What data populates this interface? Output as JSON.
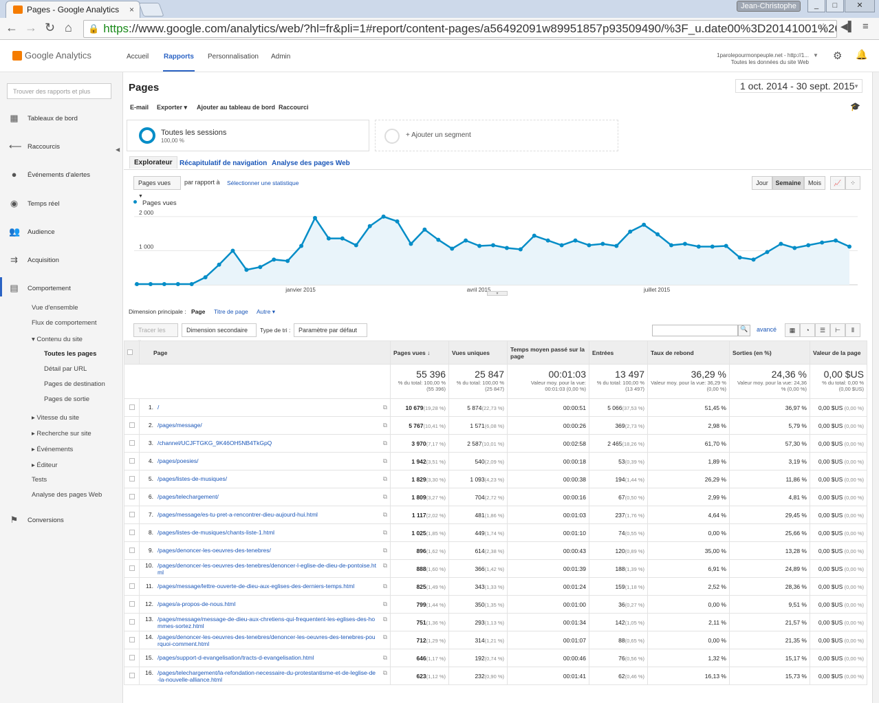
{
  "browser": {
    "tab_title": "Pages - Google Analytics",
    "tab_close": "×",
    "user": "Jean-Christophe",
    "url_https": "https",
    "url_rest": "://www.google.com/analytics/web/?hl=fr&pli=1#report/content-pages/a56492091w89951857p93509490/%3F_u.date00%3D20141001%26_u"
  },
  "header": {
    "logo": "Google Analytics",
    "nav": [
      "Accueil",
      "Rapports",
      "Personnalisation",
      "Admin"
    ],
    "account_line1": "1parolepourmonpeuple.net - http://1...",
    "account_line2": "Toutes les données du site Web"
  },
  "sidebar": {
    "search_placeholder": "Trouver des rapports et plus",
    "items": [
      "Tableaux de bord",
      "Raccourcis",
      "Événements d'alertes",
      "Temps réel",
      "Audience",
      "Acquisition",
      "Comportement",
      "Conversions"
    ],
    "sub": [
      "Vue d'ensemble",
      "Flux de comportement",
      "Contenu du site",
      "Toutes les pages",
      "Détail par URL",
      "Pages de destination",
      "Pages de sortie",
      "Vitesse du site",
      "Recherche sur site",
      "Événements",
      "Éditeur",
      "Tests",
      "Analyse des pages Web"
    ]
  },
  "report": {
    "title": "Pages",
    "date_range": "1 oct. 2014 - 30 sept. 2015",
    "actions": [
      "E-mail",
      "Exporter",
      "Ajouter au tableau de bord",
      "Raccourci"
    ],
    "segment_name": "Toutes les sessions",
    "segment_pct": "100,00 %",
    "add_segment": "+ Ajouter un segment",
    "tabs": [
      "Explorateur",
      "Récapitulatif de navigation",
      "Analyse des pages Web"
    ],
    "metric_select": "Pages vues",
    "par_rapport": "par rapport à",
    "select_stat": "Sélectionner une statistique",
    "period_buttons": [
      "Jour",
      "Semaine",
      "Mois"
    ],
    "legend": "Pages vues",
    "dim_label": "Dimension principale :",
    "dim_page": "Page",
    "dim_title": "Titre de page",
    "dim_other": "Autre",
    "trace": "Tracer les lignes",
    "secondary": "Dimension secondaire",
    "sort_label": "Type de tri :",
    "sort_value": "Paramètre par défaut",
    "advanced": "avancé"
  },
  "chart_data": {
    "type": "line",
    "series": [
      {
        "name": "Pages vues",
        "values": [
          20,
          20,
          20,
          20,
          20,
          220,
          590,
          1000,
          440,
          520,
          740,
          700,
          1140,
          1960,
          1360,
          1360,
          1160,
          1720,
          2000,
          1860,
          1200,
          1620,
          1320,
          1060,
          1300,
          1140,
          1160,
          1080,
          1040,
          1440,
          1300,
          1160,
          1300,
          1160,
          1200,
          1140,
          1560,
          1760,
          1480,
          1160,
          1200,
          1120,
          1120,
          1140,
          800,
          740,
          960,
          1200,
          1080,
          1160,
          1240,
          1300,
          1120
        ]
      }
    ],
    "y_ticks": [
      "2 000",
      "1 000"
    ],
    "x_ticks": [
      "janvier 2015",
      "avril 2015",
      "juillet 2015"
    ],
    "ylim": [
      0,
      2200
    ],
    "color": "#058dc7"
  },
  "table": {
    "headers": [
      "Page",
      "Pages vues",
      "Vues uniques",
      "Temps moyen passé sur la page",
      "Entrées",
      "Taux de rebond",
      "Sorties (en %)",
      "Valeur de la page"
    ],
    "totals": [
      {
        "big": "55 396",
        "small": "% du total: 100,00 % (55 396)"
      },
      {
        "big": "25 847",
        "small": "% du total: 100,00 % (25 847)"
      },
      {
        "big": "00:01:03",
        "small": "Valeur moy. pour la vue: 00:01:03 (0,00 %)"
      },
      {
        "big": "13 497",
        "small": "% du total: 100,00 % (13 497)"
      },
      {
        "big": "36,29 %",
        "small": "Valeur moy. pour la vue: 36,29 % (0,00 %)"
      },
      {
        "big": "24,36 %",
        "small": "Valeur moy. pour la vue: 24,36 % (0,00 %)"
      },
      {
        "big": "0,00 $US",
        "small": "% du total: 0,00 % (0,00 $US)"
      }
    ],
    "rows": [
      {
        "n": "1.",
        "page": "/",
        "pv": "10 679",
        "pvp": "(19,28 %)",
        "vu": "5 874",
        "vup": "(22,73 %)",
        "t": "00:00:51",
        "e": "5 066",
        "ep": "(37,53 %)",
        "b": "51,45 %",
        "s": "36,97 %",
        "v": "0,00 $US",
        "vp": "(0,00 %)"
      },
      {
        "n": "2.",
        "page": "/pages/message/",
        "pv": "5 767",
        "pvp": "(10,41 %)",
        "vu": "1 571",
        "vup": "(6,08 %)",
        "t": "00:00:26",
        "e": "369",
        "ep": "(2,73 %)",
        "b": "2,98 %",
        "s": "5,79 %",
        "v": "0,00 $US",
        "vp": "(0,00 %)"
      },
      {
        "n": "3.",
        "page": "/channel/UCJFTGKG_9K46OH5NB4TkGpQ",
        "pv": "3 970",
        "pvp": "(7,17 %)",
        "vu": "2 587",
        "vup": "(10,01 %)",
        "t": "00:02:58",
        "e": "2 465",
        "ep": "(18,26 %)",
        "b": "61,70 %",
        "s": "57,30 %",
        "v": "0,00 $US",
        "vp": "(0,00 %)"
      },
      {
        "n": "4.",
        "page": "/pages/poesies/",
        "pv": "1 942",
        "pvp": "(3,51 %)",
        "vu": "540",
        "vup": "(2,09 %)",
        "t": "00:00:18",
        "e": "53",
        "ep": "(0,39 %)",
        "b": "1,89 %",
        "s": "3,19 %",
        "v": "0,00 $US",
        "vp": "(0,00 %)"
      },
      {
        "n": "5.",
        "page": "/pages/listes-de-musiques/",
        "pv": "1 829",
        "pvp": "(3,30 %)",
        "vu": "1 093",
        "vup": "(4,23 %)",
        "t": "00:00:38",
        "e": "194",
        "ep": "(1,44 %)",
        "b": "26,29 %",
        "s": "11,86 %",
        "v": "0,00 $US",
        "vp": "(0,00 %)"
      },
      {
        "n": "6.",
        "page": "/pages/telechargement/",
        "pv": "1 809",
        "pvp": "(3,27 %)",
        "vu": "704",
        "vup": "(2,72 %)",
        "t": "00:00:16",
        "e": "67",
        "ep": "(0,50 %)",
        "b": "2,99 %",
        "s": "4,81 %",
        "v": "0,00 $US",
        "vp": "(0,00 %)"
      },
      {
        "n": "7.",
        "page": "/pages/message/es-tu-pret-a-rencontrer-dieu-aujourd-hui.html",
        "pv": "1 117",
        "pvp": "(2,02 %)",
        "vu": "481",
        "vup": "(1,86 %)",
        "t": "00:01:03",
        "e": "237",
        "ep": "(1,76 %)",
        "b": "4,64 %",
        "s": "29,45 %",
        "v": "0,00 $US",
        "vp": "(0,00 %)"
      },
      {
        "n": "8.",
        "page": "/pages/listes-de-musiques/chants-liste-1.html",
        "pv": "1 025",
        "pvp": "(1,85 %)",
        "vu": "449",
        "vup": "(1,74 %)",
        "t": "00:01:10",
        "e": "74",
        "ep": "(0,55 %)",
        "b": "0,00 %",
        "s": "25,66 %",
        "v": "0,00 $US",
        "vp": "(0,00 %)"
      },
      {
        "n": "9.",
        "page": "/pages/denoncer-les-oeuvres-des-tenebres/",
        "pv": "896",
        "pvp": "(1,62 %)",
        "vu": "614",
        "vup": "(2,38 %)",
        "t": "00:00:43",
        "e": "120",
        "ep": "(0,89 %)",
        "b": "35,00 %",
        "s": "13,28 %",
        "v": "0,00 $US",
        "vp": "(0,00 %)"
      },
      {
        "n": "10.",
        "page": "/pages/denoncer-les-oeuvres-des-tenebres/denoncer-l-eglise-de-dieu-de-pontoise.html",
        "pv": "888",
        "pvp": "(1,60 %)",
        "vu": "366",
        "vup": "(1,42 %)",
        "t": "00:01:39",
        "e": "188",
        "ep": "(1,39 %)",
        "b": "6,91 %",
        "s": "24,89 %",
        "v": "0,00 $US",
        "vp": "(0,00 %)"
      },
      {
        "n": "11.",
        "page": "/pages/message/lettre-ouverte-de-dieu-aux-eglises-des-derniers-temps.html",
        "pv": "825",
        "pvp": "(1,49 %)",
        "vu": "343",
        "vup": "(1,33 %)",
        "t": "00:01:24",
        "e": "159",
        "ep": "(1,18 %)",
        "b": "2,52 %",
        "s": "28,36 %",
        "v": "0,00 $US",
        "vp": "(0,00 %)"
      },
      {
        "n": "12.",
        "page": "/pages/a-propos-de-nous.html",
        "pv": "799",
        "pvp": "(1,44 %)",
        "vu": "350",
        "vup": "(1,35 %)",
        "t": "00:01:00",
        "e": "36",
        "ep": "(0,27 %)",
        "b": "0,00 %",
        "s": "9,51 %",
        "v": "0,00 $US",
        "vp": "(0,00 %)"
      },
      {
        "n": "13.",
        "page": "/pages/message/message-de-dieu-aux-chretiens-qui-frequentent-les-eglises-des-hommes-sortez.html",
        "pv": "751",
        "pvp": "(1,36 %)",
        "vu": "293",
        "vup": "(1,13 %)",
        "t": "00:01:34",
        "e": "142",
        "ep": "(1,05 %)",
        "b": "2,11 %",
        "s": "21,57 %",
        "v": "0,00 $US",
        "vp": "(0,00 %)"
      },
      {
        "n": "14.",
        "page": "/pages/denoncer-les-oeuvres-des-tenebres/denoncer-les-oeuvres-des-tenebres-pourquoi-comment.html",
        "pv": "712",
        "pvp": "(1,29 %)",
        "vu": "314",
        "vup": "(1,21 %)",
        "t": "00:01:07",
        "e": "88",
        "ep": "(0,65 %)",
        "b": "0,00 %",
        "s": "21,35 %",
        "v": "0,00 $US",
        "vp": "(0,00 %)"
      },
      {
        "n": "15.",
        "page": "/pages/support-d-evangelisation/tracts-d-evangelisation.html",
        "pv": "646",
        "pvp": "(1,17 %)",
        "vu": "192",
        "vup": "(0,74 %)",
        "t": "00:00:46",
        "e": "76",
        "ep": "(0,56 %)",
        "b": "1,32 %",
        "s": "15,17 %",
        "v": "0,00 $US",
        "vp": "(0,00 %)"
      },
      {
        "n": "16.",
        "page": "/pages/telechargement/la-refondation-necessaire-du-protestantisme-et-de-leglise-de-la-nouvelle-alliance.html",
        "pv": "623",
        "pvp": "(1,12 %)",
        "vu": "232",
        "vup": "(0,90 %)",
        "t": "00:01:41",
        "e": "62",
        "ep": "(0,46 %)",
        "b": "16,13 %",
        "s": "15,73 %",
        "v": "0,00 $US",
        "vp": "(0,00 %)"
      }
    ]
  }
}
